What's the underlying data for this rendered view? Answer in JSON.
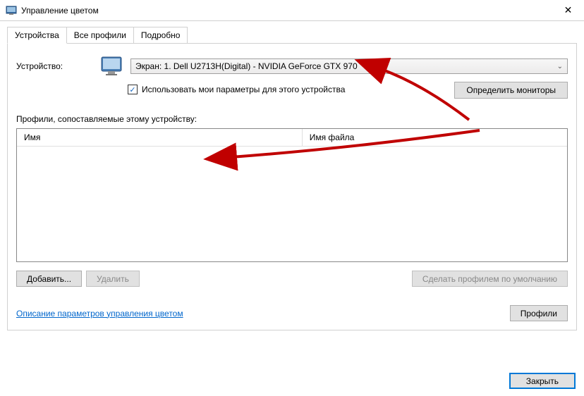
{
  "window": {
    "title": "Управление цветом",
    "close_x": "✕"
  },
  "tabs": {
    "devices": "Устройства",
    "all_profiles": "Все профили",
    "details": "Подробно"
  },
  "device": {
    "label": "Устройство:",
    "selected": "Экран: 1. Dell U2713H(Digital) - NVIDIA GeForce GTX 970",
    "use_my_settings": "Использовать мои параметры для этого устройства",
    "identify_button": "Определить мониторы"
  },
  "profiles": {
    "section_label": "Профили, сопоставляемые этому устройству:",
    "col_name": "Имя",
    "col_filename": "Имя файла"
  },
  "buttons": {
    "add": "Добавить...",
    "remove": "Удалить",
    "set_default": "Сделать профилем по умолчанию",
    "profiles": "Профили",
    "close": "Закрыть"
  },
  "link": {
    "text": "Описание параметров управления цветом"
  }
}
